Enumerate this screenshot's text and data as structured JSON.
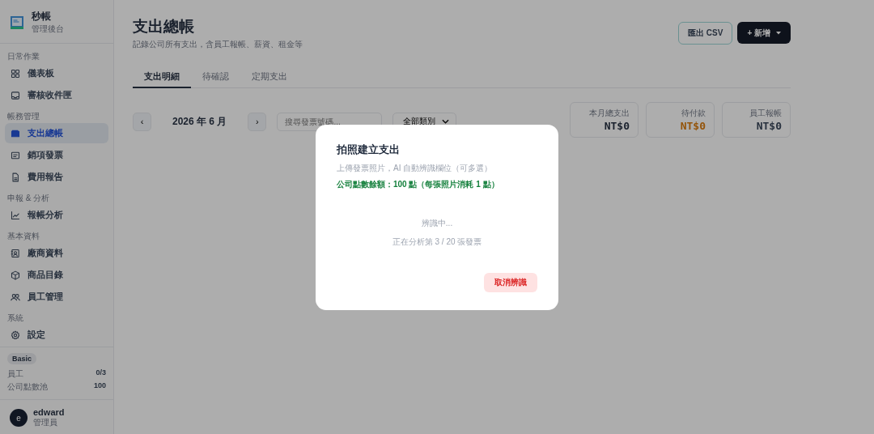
{
  "brand": {
    "name": "秒帳",
    "subtitle": "管理後台"
  },
  "sidebar": {
    "sections": [
      {
        "label": "日常作業",
        "items": [
          {
            "label": "儀表板",
            "selected": false
          },
          {
            "label": "審核收件匣",
            "selected": false
          }
        ]
      },
      {
        "label": "帳務管理",
        "items": [
          {
            "label": "支出總帳",
            "selected": true
          },
          {
            "label": "銷項發票",
            "selected": false
          },
          {
            "label": "費用報告",
            "selected": false
          }
        ]
      },
      {
        "label": "申報 & 分析",
        "items": [
          {
            "label": "報帳分析",
            "selected": false
          }
        ]
      },
      {
        "label": "基本資料",
        "items": [
          {
            "label": "廠商資料",
            "selected": false
          },
          {
            "label": "商品目錄",
            "selected": false
          },
          {
            "label": "員工管理",
            "selected": false
          }
        ]
      },
      {
        "label": "系統",
        "items": [
          {
            "label": "設定",
            "selected": false
          }
        ]
      }
    ]
  },
  "plan": {
    "badge": "Basic",
    "stats": [
      {
        "label": "員工",
        "value": "0/3"
      },
      {
        "label": "公司點數池",
        "value": "100"
      }
    ]
  },
  "user": {
    "initial": "e",
    "name": "edward",
    "role": "管理員"
  },
  "page": {
    "title": "支出總帳",
    "subtitle": "記錄公司所有支出，含員工報帳、薪資、租金等"
  },
  "actions": {
    "export": "匯出 CSV",
    "add": "+ 新增"
  },
  "tabs": [
    {
      "label": "支出明細",
      "selected": true
    },
    {
      "label": "待確認",
      "selected": false
    },
    {
      "label": "定期支出",
      "selected": false
    }
  ],
  "month": {
    "prev": "‹",
    "label": "2026 年 6 月",
    "next": "›"
  },
  "search": {
    "placeholder": "搜尋發票號碼..."
  },
  "filter": {
    "label": "全部類別"
  },
  "summary": [
    {
      "label": "本月總支出",
      "value": "NT$0",
      "kind": "normal"
    },
    {
      "label": "待付款",
      "value": "NT$0",
      "kind": "warning"
    },
    {
      "label": "員工報帳",
      "value": "NT$0",
      "kind": "muted"
    }
  ],
  "modal": {
    "title": "拍照建立支出",
    "description": "上傳發票照片，AI 自動辨識欄位（可多選）",
    "credits": "公司點數餘額：100 點（每張照片消耗 1 點）",
    "status": "辨識中...",
    "progress": "正在分析第 3 / 20 張發票",
    "cancel": "取消辨識"
  }
}
